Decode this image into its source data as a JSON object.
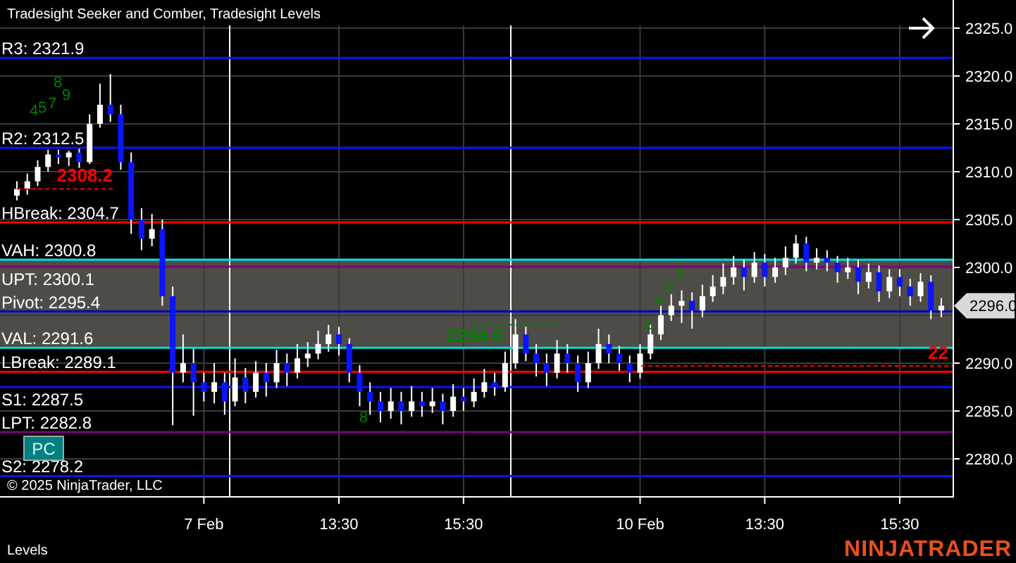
{
  "chart_title": "Tradesight Seeker and Comber, Tradesight Levels",
  "price_chart": {
    "chart_data": {
      "type": "candlestick",
      "ylim": [
        2276.03,
        2327.94
      ],
      "categories": [
        null,
        null,
        null,
        null,
        null,
        null,
        null,
        null,
        null,
        null,
        null,
        null,
        null,
        null,
        null,
        null,
        null,
        null,
        "7 Feb",
        null,
        null,
        null,
        null,
        null,
        null,
        null,
        null,
        null,
        null,
        null,
        null,
        "13:30",
        null,
        null,
        null,
        null,
        null,
        null,
        null,
        null,
        null,
        null,
        null,
        "15:30",
        null,
        null,
        null,
        null,
        null,
        null,
        null,
        null,
        null,
        null,
        null,
        null,
        null,
        null,
        null,
        null,
        "10 Feb",
        null,
        null,
        null,
        null,
        null,
        null,
        null,
        null,
        null,
        null,
        null,
        "13:30",
        null,
        null,
        null,
        null,
        null,
        null,
        null,
        null,
        null,
        null,
        null,
        null,
        "15:30",
        null,
        null,
        null,
        null
      ],
      "ohlc": [
        [
          2307.5,
          2309,
          2307,
          2308.2
        ],
        [
          2308.2,
          2309.8,
          2307.6,
          2309
        ],
        [
          2309,
          2311.2,
          2308.5,
          2310.5
        ],
        [
          2310.5,
          2312.3,
          2310,
          2311.8
        ],
        [
          2311.8,
          2312.3,
          2310.8,
          2311.5
        ],
        [
          2311.5,
          2312.2,
          2310.6,
          2312
        ],
        [
          2312,
          2312.4,
          2310.4,
          2311
        ],
        [
          2311,
          2316,
          2310.8,
          2315
        ],
        [
          2315,
          2319.2,
          2314.6,
          2317
        ],
        [
          2317,
          2320.2,
          2315.2,
          2316
        ],
        [
          2316,
          2317,
          2310.2,
          2311
        ],
        [
          2311,
          2312,
          2303.5,
          2305
        ],
        [
          2305,
          2306.2,
          2301.8,
          2303
        ],
        [
          2303,
          2305.6,
          2302.2,
          2304
        ],
        [
          2304,
          2305,
          2296,
          2297
        ],
        [
          2297,
          2298,
          2283.5,
          2289
        ],
        [
          2289,
          2293,
          2288,
          2290
        ],
        [
          2290,
          2291.5,
          2284.5,
          2288
        ],
        [
          2288,
          2289,
          2286,
          2287
        ],
        [
          2287,
          2290,
          2285.8,
          2288
        ],
        [
          2288,
          2289,
          2284.6,
          2286
        ],
        [
          2286,
          2290.5,
          2285.5,
          2288.5
        ],
        [
          2288.5,
          2289.5,
          2285.8,
          2287
        ],
        [
          2287,
          2290.2,
          2286.4,
          2289
        ],
        [
          2289,
          2290,
          2286.5,
          2288
        ],
        [
          2288,
          2291.4,
          2287.4,
          2290
        ],
        [
          2290,
          2291,
          2287.6,
          2289
        ],
        [
          2289,
          2292,
          2288.4,
          2290.5
        ],
        [
          2290.5,
          2292.2,
          2289.6,
          2291
        ],
        [
          2291,
          2293.4,
          2290.4,
          2292
        ],
        [
          2292,
          2294,
          2291.2,
          2293
        ],
        [
          2293,
          2293.8,
          2290.8,
          2292
        ],
        [
          2292,
          2292.6,
          2288,
          2289
        ],
        [
          2289,
          2289.8,
          2285.5,
          2287
        ],
        [
          2287,
          2288,
          2284.6,
          2286
        ],
        [
          2286,
          2287,
          2283.8,
          2285
        ],
        [
          2285,
          2287.4,
          2284.2,
          2286
        ],
        [
          2286,
          2287,
          2283.6,
          2285
        ],
        [
          2285,
          2287.6,
          2284.4,
          2286
        ],
        [
          2286,
          2287,
          2284.4,
          2285.5
        ],
        [
          2285.5,
          2287.4,
          2284.8,
          2286
        ],
        [
          2286,
          2286.8,
          2283.6,
          2285
        ],
        [
          2285,
          2287.8,
          2284.4,
          2286.5
        ],
        [
          2286.5,
          2287.4,
          2285,
          2286
        ],
        [
          2286,
          2288.4,
          2285.4,
          2287
        ],
        [
          2287,
          2289.4,
          2286.4,
          2288
        ],
        [
          2288,
          2289,
          2286.6,
          2287.5
        ],
        [
          2287.5,
          2291.2,
          2287,
          2290
        ],
        [
          2290,
          2294.6,
          2289.4,
          2293
        ],
        [
          2293,
          2293.8,
          2290.2,
          2291
        ],
        [
          2291,
          2292,
          2288.6,
          2290
        ],
        [
          2290,
          2291,
          2287.6,
          2289
        ],
        [
          2289,
          2292.4,
          2288.4,
          2291
        ],
        [
          2291,
          2292,
          2289,
          2290
        ],
        [
          2290,
          2290.8,
          2287,
          2288
        ],
        [
          2288,
          2291.2,
          2287.4,
          2290
        ],
        [
          2290,
          2293.6,
          2289.4,
          2292
        ],
        [
          2292,
          2293,
          2290,
          2291
        ],
        [
          2291,
          2291.8,
          2289.2,
          2290
        ],
        [
          2290,
          2290.8,
          2288,
          2289
        ],
        [
          2289,
          2292,
          2288.4,
          2291
        ],
        [
          2291,
          2294,
          2290.4,
          2293
        ],
        [
          2293,
          2296,
          2292.4,
          2295
        ],
        [
          2295,
          2297.2,
          2294.4,
          2296
        ],
        [
          2296,
          2297.6,
          2294.2,
          2296.5
        ],
        [
          2296.5,
          2297.4,
          2293.6,
          2295.5
        ],
        [
          2295.5,
          2298.2,
          2294.8,
          2297
        ],
        [
          2297,
          2299.2,
          2296.4,
          2298
        ],
        [
          2298,
          2300.4,
          2297.2,
          2299
        ],
        [
          2299,
          2301.2,
          2298.2,
          2300
        ],
        [
          2300,
          2300.8,
          2297.6,
          2299
        ],
        [
          2299,
          2301.6,
          2298.4,
          2300.5
        ],
        [
          2300.5,
          2301.4,
          2298,
          2299
        ],
        [
          2299,
          2301,
          2298.4,
          2300
        ],
        [
          2300,
          2302.2,
          2299.2,
          2301
        ],
        [
          2301,
          2303.4,
          2300.4,
          2302.5
        ],
        [
          2302.5,
          2303.2,
          2299.6,
          2300.5
        ],
        [
          2300.5,
          2302,
          2299.8,
          2301
        ],
        [
          2301,
          2301.8,
          2299.6,
          2300.5
        ],
        [
          2300.5,
          2301.2,
          2298.4,
          2299.5
        ],
        [
          2299.5,
          2301,
          2298.8,
          2300
        ],
        [
          2300,
          2300.8,
          2297.2,
          2298.5
        ],
        [
          2298.5,
          2300.4,
          2297.8,
          2299.5
        ],
        [
          2299.5,
          2300.2,
          2296.4,
          2297.5
        ],
        [
          2297.5,
          2299.8,
          2296.8,
          2299
        ],
        [
          2299,
          2299.8,
          2297,
          2298
        ],
        [
          2298,
          2298.8,
          2296,
          2297
        ],
        [
          2297,
          2299.4,
          2296.4,
          2298.5
        ],
        [
          2298.5,
          2299.2,
          2294.6,
          2295.5
        ],
        [
          2295.5,
          2296.8,
          2294.8,
          2296
        ]
      ],
      "grid": true,
      "yticks": [
        {
          "value": 2280,
          "label": "2280.0"
        },
        {
          "value": 2285,
          "label": "2285.0"
        },
        {
          "value": 2290,
          "label": "2290.0"
        },
        {
          "value": 2300,
          "label": "2300.0"
        },
        {
          "value": 2305,
          "label": "2305.0"
        },
        {
          "value": 2310,
          "label": "2310.0"
        },
        {
          "value": 2315,
          "label": "2315.0"
        },
        {
          "value": 2320,
          "label": "2320.0"
        },
        {
          "value": 2325,
          "label": "2325.0"
        }
      ],
      "bands": [
        {
          "axis": "y",
          "from": 2291.6,
          "to": 2300.8,
          "color": "#4e4c46"
        }
      ],
      "ref_lines": [
        {
          "axis": "y",
          "value": 2321.9,
          "label": "R3: 2321.9",
          "color": "#0a14ff"
        },
        {
          "axis": "y",
          "value": 2312.5,
          "label": "R2: 2312.5",
          "color": "#0a14ff"
        },
        {
          "axis": "y",
          "value": 2304.7,
          "label": "HBreak: 2304.7",
          "color": "#ff0000"
        },
        {
          "axis": "y",
          "value": 2300.8,
          "label": "VAH: 2300.8",
          "color": "#00e0e0"
        },
        {
          "axis": "y",
          "value": 2300.1,
          "label": "UPT: 2300.1",
          "color": "#800080"
        },
        {
          "axis": "y",
          "value": 2295.4,
          "label": "Pivot: 2295.4",
          "color": "#0000c8"
        },
        {
          "axis": "y",
          "value": 2291.6,
          "label": "VAL: 2291.6",
          "color": "#00e0e0"
        },
        {
          "axis": "y",
          "value": 2289.1,
          "label": "LBreak: 2289.1",
          "color": "#ff0000"
        },
        {
          "axis": "y",
          "value": 2287.5,
          "label": "S1: 2287.5",
          "color": "#0a14ff"
        },
        {
          "axis": "y",
          "value": 2282.8,
          "label": "LPT: 2282.8",
          "color": "#800080"
        },
        {
          "axis": "y",
          "value": 2278.2,
          "label": "S2: 2278.2",
          "color": "#0a14ff"
        }
      ],
      "annotations": [
        "8",
        "9",
        "7",
        "5",
        "4",
        "8",
        "2",
        "4",
        "6",
        "8"
      ]
    },
    "price_marks": [
      {
        "text": "2308.2",
        "color": "#ff0000"
      },
      {
        "text": "22",
        "color": "#ff0000"
      },
      {
        "text": "2294.0",
        "color": "#008000"
      }
    ],
    "last_price": "2296.0"
  },
  "pc_badge": "PC",
  "copyright": "© 2025 NinjaTrader, LLC",
  "panel_label": "Levels",
  "brand": "NINJATRADER"
}
